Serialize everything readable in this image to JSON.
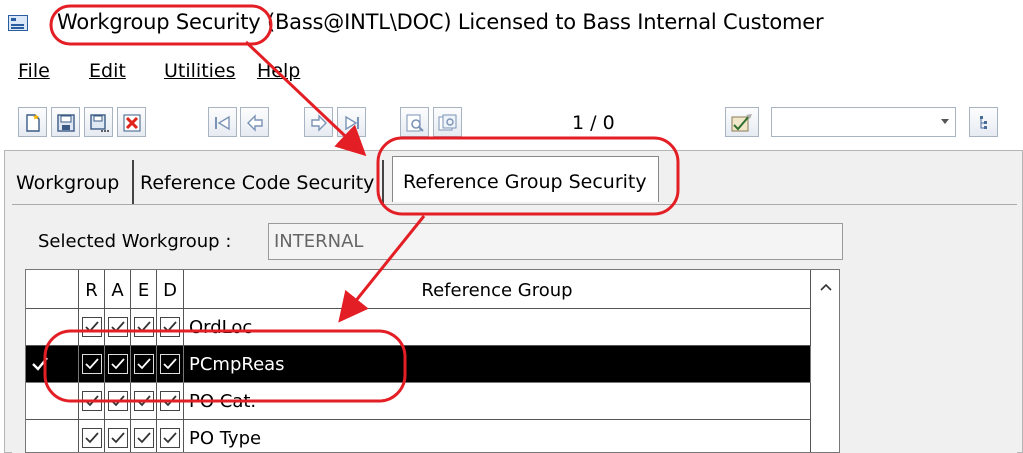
{
  "window": {
    "title": "Workgroup Security (Bass@INTL\\DOC) Licensed to Bass Internal Customer",
    "icon": "app-window-icon"
  },
  "menu": {
    "items": [
      {
        "label": "File"
      },
      {
        "label": "Edit"
      },
      {
        "label": "Utilities"
      },
      {
        "label": "Help"
      }
    ]
  },
  "toolbar": {
    "buttons": [
      {
        "icon": "new-icon"
      },
      {
        "icon": "save-icon"
      },
      {
        "icon": "save-as-icon"
      },
      {
        "icon": "delete-icon"
      },
      {
        "icon": "first-record-icon"
      },
      {
        "icon": "previous-record-icon"
      },
      {
        "icon": "next-record-icon"
      },
      {
        "icon": "last-record-icon"
      },
      {
        "icon": "find-icon"
      },
      {
        "icon": "browse-icon"
      },
      {
        "icon": "check-edit-icon"
      },
      {
        "icon": "tree-view-icon"
      }
    ],
    "record_counter": "1 / 0",
    "combo_value": ""
  },
  "tabs": [
    {
      "label": "Workgroup",
      "active": false
    },
    {
      "label": "Reference Code Security",
      "active": false
    },
    {
      "label": "Reference Group Security",
      "active": true
    }
  ],
  "form": {
    "selected_workgroup_label": "Selected Workgroup :",
    "selected_workgroup_value": "INTERNAL"
  },
  "grid": {
    "columns": [
      "R",
      "A",
      "E",
      "D",
      "Reference Group"
    ],
    "rows": [
      {
        "R": true,
        "A": true,
        "E": true,
        "D": true,
        "group": "OrdLoc",
        "selected": false
      },
      {
        "R": true,
        "A": true,
        "E": true,
        "D": true,
        "group": "PCmpReas",
        "selected": true
      },
      {
        "R": true,
        "A": true,
        "E": true,
        "D": true,
        "group": "PO Cat.",
        "selected": false
      },
      {
        "R": true,
        "A": true,
        "E": true,
        "D": true,
        "group": "PO Type",
        "selected": false
      }
    ]
  },
  "colors": {
    "annotation": "#e31e24",
    "selected_row_bg": "#000000",
    "selected_row_text": "#ffffff"
  }
}
